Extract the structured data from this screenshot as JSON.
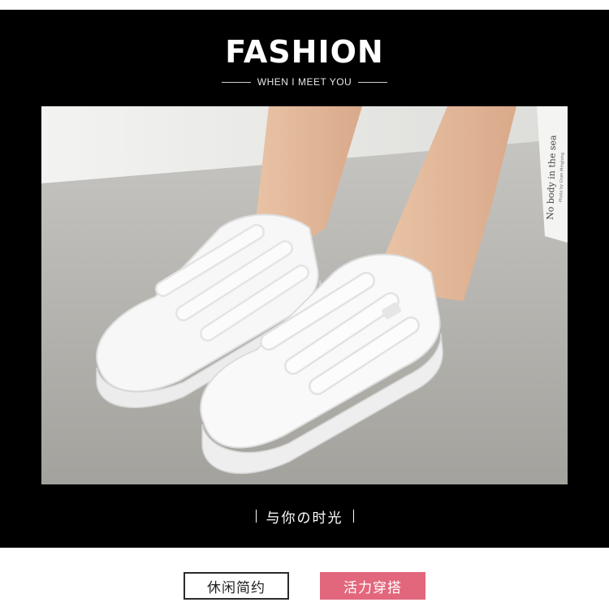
{
  "header": {
    "title": "FASHION",
    "subtitle": "WHEN I MEET YOU"
  },
  "photo": {
    "book_text_line1": "No body in the sea",
    "book_text_line2": "Photo by Chen Minglong"
  },
  "caption": {
    "text": "与你の时光"
  },
  "tags": [
    {
      "label": "休闲简约",
      "style": "outline"
    },
    {
      "label": "活力穿搭",
      "style": "filled",
      "color": "#e2677d"
    }
  ],
  "colors": {
    "panel": "#000000",
    "accent": "#e2677d"
  }
}
